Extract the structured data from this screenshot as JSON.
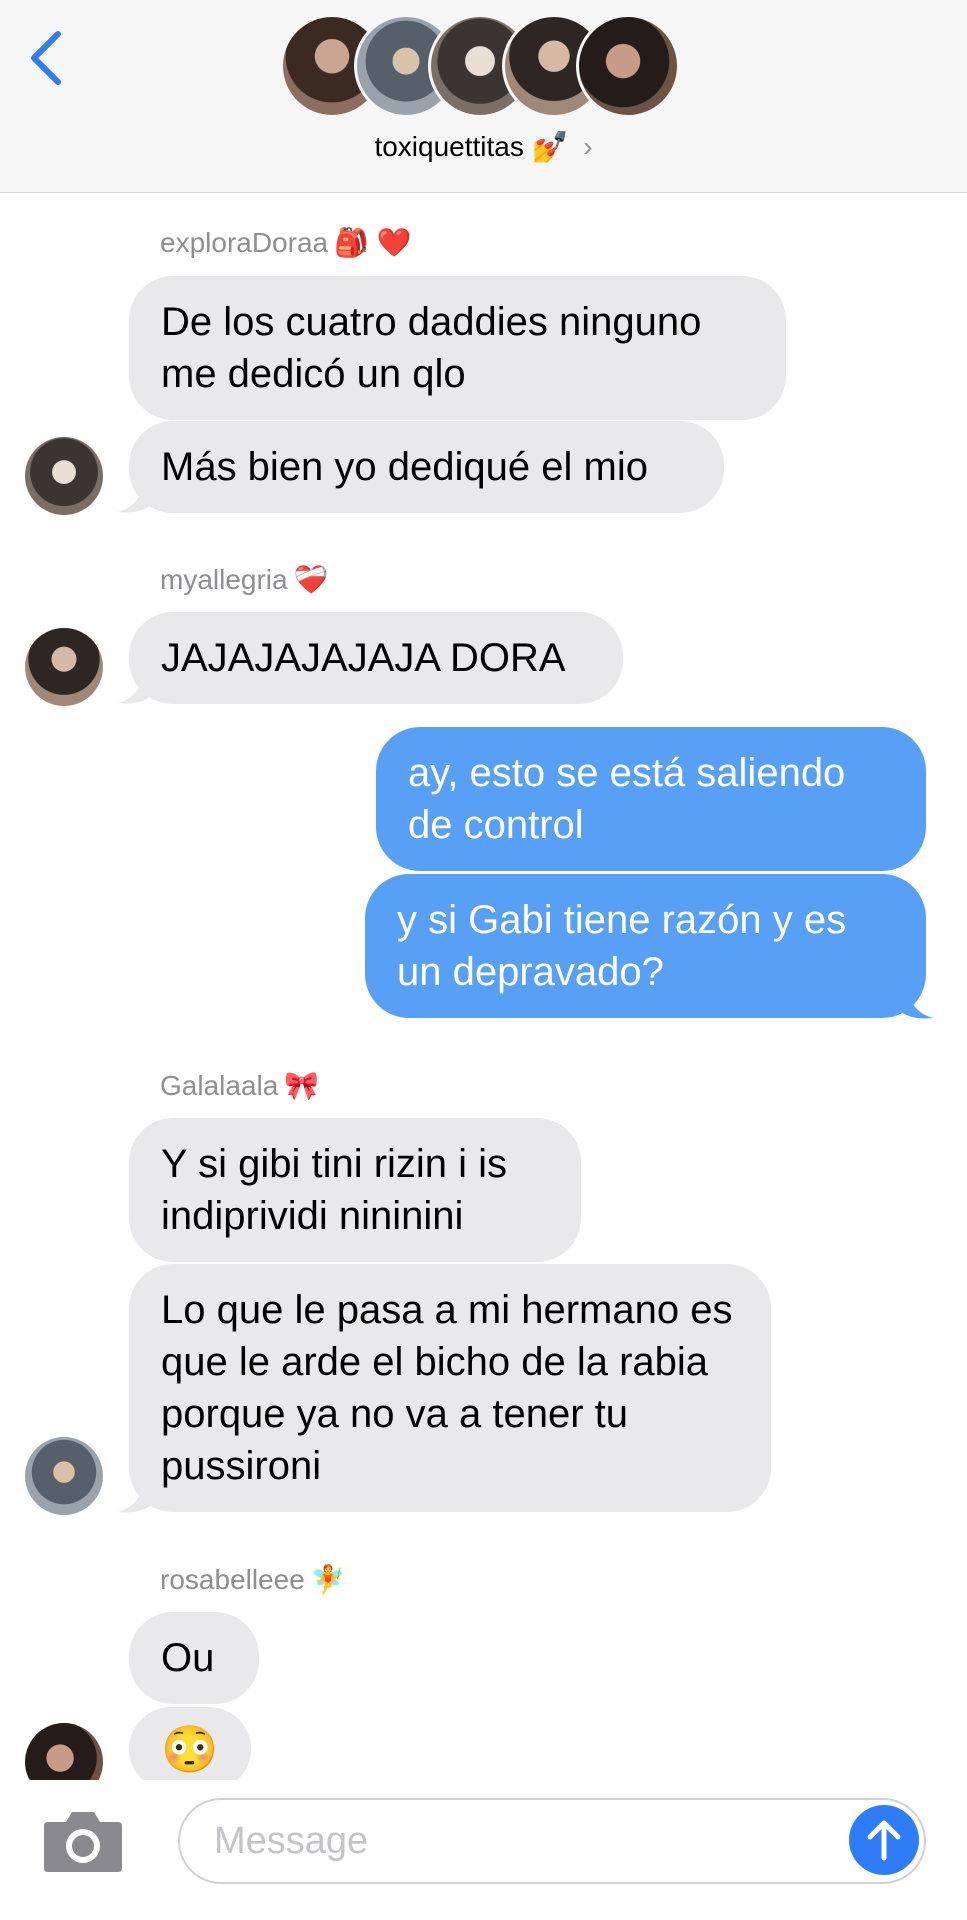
{
  "header": {
    "title": "toxiquettitas",
    "title_emoji": "💅"
  },
  "input": {
    "placeholder": "Message"
  },
  "colors": {
    "outgoing_bubble": "#57a0f5",
    "incoming_bubble": "#e9e9eb",
    "accent": "#2f7df6"
  },
  "messages": {
    "g1": {
      "sender": "exploraDoraa",
      "sender_emoji": "🎒 ❤️",
      "m1": "De los cuatro daddies ninguno me dedicó un qlo",
      "m2": "Más bien yo dediqué el mio"
    },
    "g2": {
      "sender": "myallegria",
      "sender_emoji": "❤️‍🩹",
      "m1": "JAJAJAJAJAJA DORA"
    },
    "g3": {
      "m1": "ay, esto se está saliendo de control",
      "m2": "y si Gabi tiene razón y es un depravado?"
    },
    "g4": {
      "sender": "Galalaala",
      "sender_emoji": "🎀",
      "m1": "Y si gibi tini rizin i is indiprividi nininini",
      "m2": "Lo que le pasa a mi hermano es que le arde el bicho de la rabia porque ya no va a tener tu pussironi"
    },
    "g5": {
      "sender": "rosabelleee",
      "sender_emoji": "🧚",
      "m1": "Ou",
      "m2": "😳"
    }
  }
}
